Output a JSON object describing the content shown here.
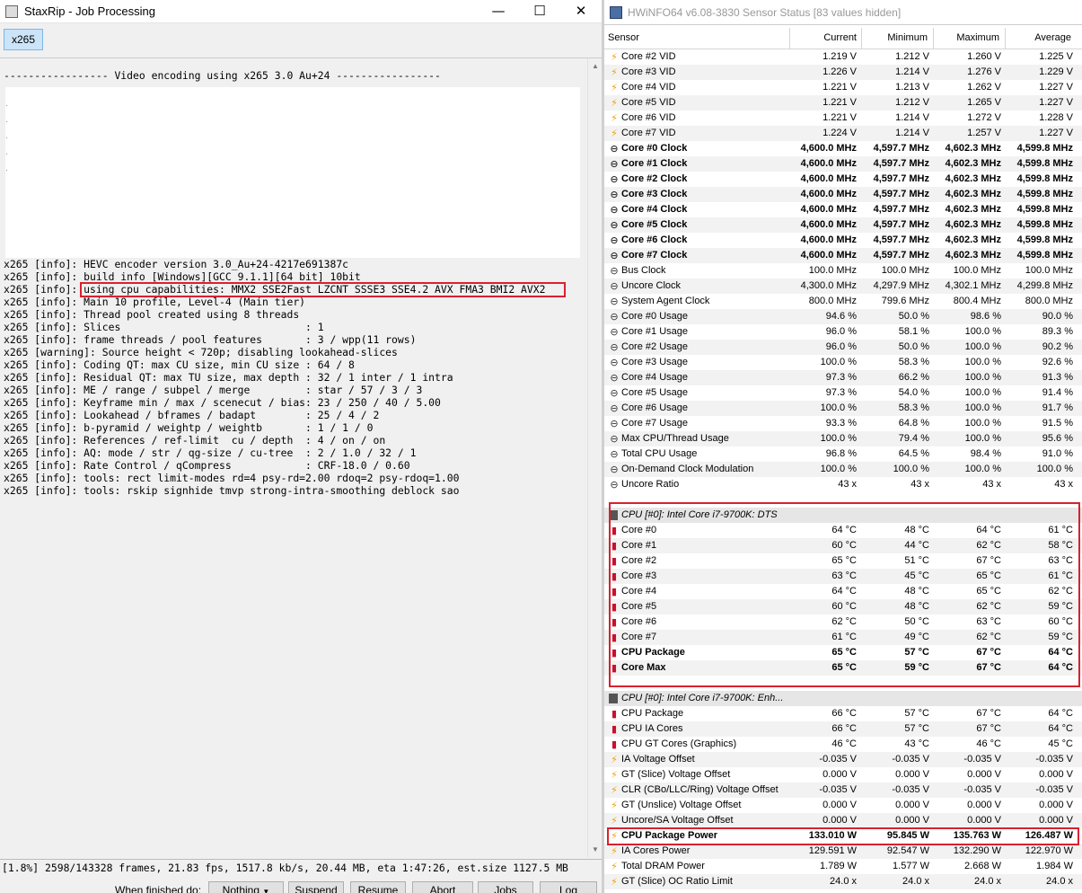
{
  "left": {
    "title": "StaxRip - Job Processing",
    "tab_label": "x265",
    "header_line": "----------------- Video encoding using x265 3.0 Au+24 -----------------",
    "log_lines": [
      "x265 [info]: HEVC encoder version 3.0_Au+24-4217e691387c",
      "x265 [info]: build info [Windows][GCC 9.1.1][64 bit] 10bit",
      "x265 [info]: using cpu capabilities: MMX2 SSE2Fast LZCNT SSSE3 SSE4.2 AVX FMA3 BMI2 AVX2",
      "x265 [info]: Main 10 profile, Level-4 (Main tier)",
      "x265 [info]: Thread pool created using 8 threads",
      "x265 [info]: Slices                              : 1",
      "x265 [info]: frame threads / pool features       : 3 / wpp(11 rows)",
      "x265 [warning]: Source height < 720p; disabling lookahead-slices",
      "x265 [info]: Coding QT: max CU size, min CU size : 64 / 8",
      "x265 [info]: Residual QT: max TU size, max depth : 32 / 1 inter / 1 intra",
      "x265 [info]: ME / range / subpel / merge         : star / 57 / 3 / 3",
      "x265 [info]: Keyframe min / max / scenecut / bias: 23 / 250 / 40 / 5.00",
      "x265 [info]: Lookahead / bframes / badapt        : 25 / 4 / 2",
      "x265 [info]: b-pyramid / weightp / weightb       : 1 / 1 / 0",
      "x265 [info]: References / ref-limit  cu / depth  : 4 / on / on",
      "x265 [info]: AQ: mode / str / qg-size / cu-tree  : 2 / 1.0 / 32 / 1",
      "x265 [info]: Rate Control / qCompress            : CRF-18.0 / 0.60",
      "x265 [info]: tools: rect limit-modes rd=4 psy-rd=2.00 rdoq=2 psy-rdoq=1.00",
      "x265 [info]: tools: rskip signhide tmvp strong-intra-smoothing deblock sao"
    ],
    "status_line": "[1.8%] 2598/143328 frames, 21.83 fps, 1517.8 kb/s, 20.44 MB, eta 1:47:26, est.size 1127.5 MB",
    "finished_label": "When finished do:",
    "finished_value": "Nothing",
    "buttons": {
      "suspend": "Suspend",
      "resume": "Resume",
      "abort": "Abort",
      "jobs": "Jobs",
      "log": "Log"
    }
  },
  "right": {
    "title": "HWiNFO64 v6.08-3830 Sensor Status [83 values hidden]",
    "columns": [
      "Sensor",
      "Current",
      "Minimum",
      "Maximum",
      "Average"
    ],
    "rows_top": [
      {
        "icon": "bolt",
        "name": "Core #2 VID",
        "v": [
          "1.219 V",
          "1.212 V",
          "1.260 V",
          "1.225 V"
        ]
      },
      {
        "icon": "bolt",
        "name": "Core #3 VID",
        "v": [
          "1.226 V",
          "1.214 V",
          "1.276 V",
          "1.229 V"
        ]
      },
      {
        "icon": "bolt",
        "name": "Core #4 VID",
        "v": [
          "1.221 V",
          "1.213 V",
          "1.262 V",
          "1.227 V"
        ]
      },
      {
        "icon": "bolt",
        "name": "Core #5 VID",
        "v": [
          "1.221 V",
          "1.212 V",
          "1.265 V",
          "1.227 V"
        ]
      },
      {
        "icon": "bolt",
        "name": "Core #6 VID",
        "v": [
          "1.221 V",
          "1.214 V",
          "1.272 V",
          "1.228 V"
        ]
      },
      {
        "icon": "bolt",
        "name": "Core #7 VID",
        "v": [
          "1.224 V",
          "1.214 V",
          "1.257 V",
          "1.227 V"
        ]
      },
      {
        "icon": "clock",
        "bold": true,
        "name": "Core #0 Clock",
        "v": [
          "4,600.0 MHz",
          "4,597.7 MHz",
          "4,602.3 MHz",
          "4,599.8 MHz"
        ]
      },
      {
        "icon": "clock",
        "bold": true,
        "name": "Core #1 Clock",
        "v": [
          "4,600.0 MHz",
          "4,597.7 MHz",
          "4,602.3 MHz",
          "4,599.8 MHz"
        ]
      },
      {
        "icon": "clock",
        "bold": true,
        "name": "Core #2 Clock",
        "v": [
          "4,600.0 MHz",
          "4,597.7 MHz",
          "4,602.3 MHz",
          "4,599.8 MHz"
        ]
      },
      {
        "icon": "clock",
        "bold": true,
        "name": "Core #3 Clock",
        "v": [
          "4,600.0 MHz",
          "4,597.7 MHz",
          "4,602.3 MHz",
          "4,599.8 MHz"
        ]
      },
      {
        "icon": "clock",
        "bold": true,
        "name": "Core #4 Clock",
        "v": [
          "4,600.0 MHz",
          "4,597.7 MHz",
          "4,602.3 MHz",
          "4,599.8 MHz"
        ]
      },
      {
        "icon": "clock",
        "bold": true,
        "name": "Core #5 Clock",
        "v": [
          "4,600.0 MHz",
          "4,597.7 MHz",
          "4,602.3 MHz",
          "4,599.8 MHz"
        ]
      },
      {
        "icon": "clock",
        "bold": true,
        "name": "Core #6 Clock",
        "v": [
          "4,600.0 MHz",
          "4,597.7 MHz",
          "4,602.3 MHz",
          "4,599.8 MHz"
        ]
      },
      {
        "icon": "clock",
        "bold": true,
        "name": "Core #7 Clock",
        "v": [
          "4,600.0 MHz",
          "4,597.7 MHz",
          "4,602.3 MHz",
          "4,599.8 MHz"
        ]
      },
      {
        "icon": "clock",
        "name": "Bus Clock",
        "v": [
          "100.0 MHz",
          "100.0 MHz",
          "100.0 MHz",
          "100.0 MHz"
        ]
      },
      {
        "icon": "clock",
        "name": "Uncore Clock",
        "v": [
          "4,300.0 MHz",
          "4,297.9 MHz",
          "4,302.1 MHz",
          "4,299.8 MHz"
        ]
      },
      {
        "icon": "clock",
        "name": "System Agent Clock",
        "v": [
          "800.0 MHz",
          "799.6 MHz",
          "800.4 MHz",
          "800.0 MHz"
        ]
      },
      {
        "icon": "clock",
        "name": "Core #0 Usage",
        "v": [
          "94.6 %",
          "50.0 %",
          "98.6 %",
          "90.0 %"
        ]
      },
      {
        "icon": "clock",
        "name": "Core #1 Usage",
        "v": [
          "96.0 %",
          "58.1 %",
          "100.0 %",
          "89.3 %"
        ]
      },
      {
        "icon": "clock",
        "name": "Core #2 Usage",
        "v": [
          "96.0 %",
          "50.0 %",
          "100.0 %",
          "90.2 %"
        ]
      },
      {
        "icon": "clock",
        "name": "Core #3 Usage",
        "v": [
          "100.0 %",
          "58.3 %",
          "100.0 %",
          "92.6 %"
        ]
      },
      {
        "icon": "clock",
        "name": "Core #4 Usage",
        "v": [
          "97.3 %",
          "66.2 %",
          "100.0 %",
          "91.3 %"
        ]
      },
      {
        "icon": "clock",
        "name": "Core #5 Usage",
        "v": [
          "97.3 %",
          "54.0 %",
          "100.0 %",
          "91.4 %"
        ]
      },
      {
        "icon": "clock",
        "name": "Core #6 Usage",
        "v": [
          "100.0 %",
          "58.3 %",
          "100.0 %",
          "91.7 %"
        ]
      },
      {
        "icon": "clock",
        "name": "Core #7 Usage",
        "v": [
          "93.3 %",
          "64.8 %",
          "100.0 %",
          "91.5 %"
        ]
      },
      {
        "icon": "clock",
        "name": "Max CPU/Thread Usage",
        "v": [
          "100.0 %",
          "79.4 %",
          "100.0 %",
          "95.6 %"
        ]
      },
      {
        "icon": "clock",
        "name": "Total CPU Usage",
        "v": [
          "96.8 %",
          "64.5 %",
          "98.4 %",
          "91.0 %"
        ]
      },
      {
        "icon": "clock",
        "name": "On-Demand Clock Modulation",
        "v": [
          "100.0 %",
          "100.0 %",
          "100.0 %",
          "100.0 %"
        ]
      },
      {
        "icon": "clock",
        "name": "Uncore Ratio",
        "v": [
          "43 x",
          "43 x",
          "43 x",
          "43 x"
        ]
      }
    ],
    "group_dts": "CPU [#0]: Intel Core i7-9700K: DTS",
    "rows_dts": [
      {
        "icon": "therm",
        "name": "Core #0",
        "v": [
          "64 °C",
          "48 °C",
          "64 °C",
          "61 °C"
        ]
      },
      {
        "icon": "therm",
        "name": "Core #1",
        "v": [
          "60 °C",
          "44 °C",
          "62 °C",
          "58 °C"
        ]
      },
      {
        "icon": "therm",
        "name": "Core #2",
        "v": [
          "65 °C",
          "51 °C",
          "67 °C",
          "63 °C"
        ]
      },
      {
        "icon": "therm",
        "name": "Core #3",
        "v": [
          "63 °C",
          "45 °C",
          "65 °C",
          "61 °C"
        ]
      },
      {
        "icon": "therm",
        "name": "Core #4",
        "v": [
          "64 °C",
          "48 °C",
          "65 °C",
          "62 °C"
        ]
      },
      {
        "icon": "therm",
        "name": "Core #5",
        "v": [
          "60 °C",
          "48 °C",
          "62 °C",
          "59 °C"
        ]
      },
      {
        "icon": "therm",
        "name": "Core #6",
        "v": [
          "62 °C",
          "50 °C",
          "63 °C",
          "60 °C"
        ]
      },
      {
        "icon": "therm",
        "name": "Core #7",
        "v": [
          "61 °C",
          "49 °C",
          "62 °C",
          "59 °C"
        ]
      },
      {
        "icon": "therm",
        "bold": true,
        "name": "CPU Package",
        "v": [
          "65 °C",
          "57 °C",
          "67 °C",
          "64 °C"
        ]
      },
      {
        "icon": "therm",
        "bold": true,
        "name": "Core Max",
        "v": [
          "65 °C",
          "59 °C",
          "67 °C",
          "64 °C"
        ]
      }
    ],
    "group_enh": "CPU [#0]: Intel Core i7-9700K: Enh...",
    "rows_enh": [
      {
        "icon": "therm",
        "name": "CPU Package",
        "v": [
          "66 °C",
          "57 °C",
          "67 °C",
          "64 °C"
        ]
      },
      {
        "icon": "therm",
        "name": "CPU IA Cores",
        "v": [
          "66 °C",
          "57 °C",
          "67 °C",
          "64 °C"
        ]
      },
      {
        "icon": "therm",
        "name": "CPU GT Cores (Graphics)",
        "v": [
          "46 °C",
          "43 °C",
          "46 °C",
          "45 °C"
        ]
      },
      {
        "icon": "bolt",
        "name": "IA Voltage Offset",
        "v": [
          "-0.035 V",
          "-0.035 V",
          "-0.035 V",
          "-0.035 V"
        ]
      },
      {
        "icon": "bolt",
        "name": "GT (Slice) Voltage Offset",
        "v": [
          "0.000 V",
          "0.000 V",
          "0.000 V",
          "0.000 V"
        ]
      },
      {
        "icon": "bolt",
        "name": "CLR (CBo/LLC/Ring) Voltage Offset",
        "v": [
          "-0.035 V",
          "-0.035 V",
          "-0.035 V",
          "-0.035 V"
        ]
      },
      {
        "icon": "bolt",
        "name": "GT (Unslice) Voltage Offset",
        "v": [
          "0.000 V",
          "0.000 V",
          "0.000 V",
          "0.000 V"
        ]
      },
      {
        "icon": "bolt",
        "name": "Uncore/SA Voltage Offset",
        "v": [
          "0.000 V",
          "0.000 V",
          "0.000 V",
          "0.000 V"
        ]
      },
      {
        "icon": "bolt",
        "bold": true,
        "name": "CPU Package Power",
        "v": [
          "133.010 W",
          "95.845 W",
          "135.763 W",
          "126.487 W"
        ]
      },
      {
        "icon": "bolt",
        "name": "IA Cores Power",
        "v": [
          "129.591 W",
          "92.547 W",
          "132.290 W",
          "122.970 W"
        ]
      },
      {
        "icon": "bolt",
        "name": "Total DRAM Power",
        "v": [
          "1.789 W",
          "1.577 W",
          "2.668 W",
          "1.984 W"
        ]
      },
      {
        "icon": "bolt",
        "name": "GT (Slice) OC Ratio Limit",
        "v": [
          "24.0 x",
          "24.0 x",
          "24.0 x",
          "24.0 x"
        ]
      }
    ]
  }
}
